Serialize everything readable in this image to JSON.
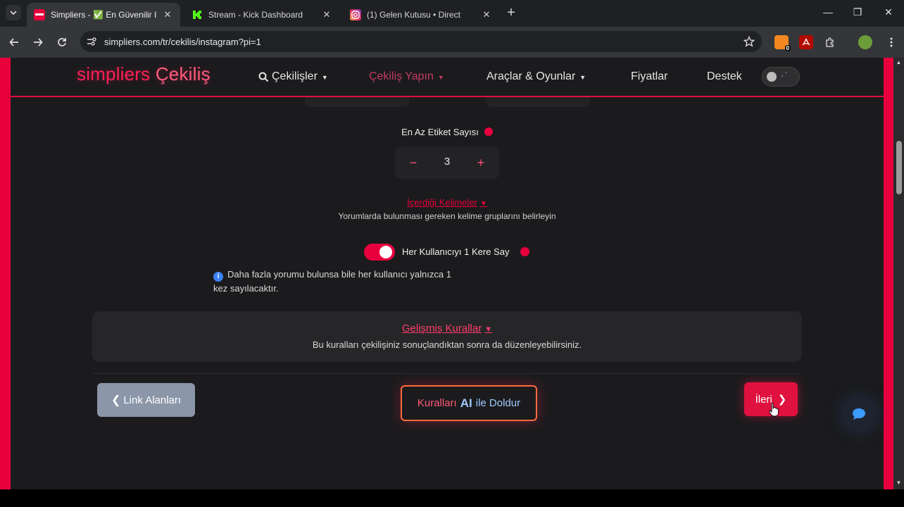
{
  "browser": {
    "tabs": [
      {
        "title": "Simpliers - ✅ En Güvenilir Inst",
        "active": true
      },
      {
        "title": "Stream - Kick Dashboard",
        "active": false
      },
      {
        "title": "(1) Gelen Kutusu • Direct",
        "active": false
      }
    ],
    "close_glyph": "✕",
    "new_tab_glyph": "+",
    "url": "simpliers.com/tr/cekilis/instagram?pi=1",
    "extension_badge": "0",
    "window_controls": [
      "—",
      "❐",
      "✕"
    ]
  },
  "site": {
    "brand_part1": "simpliers",
    "brand_part2": "Çekiliş",
    "nav": [
      {
        "label": "Çekilişler"
      },
      {
        "label": "Çekiliş Yapın"
      },
      {
        "label": "Araçlar & Oyunlar"
      },
      {
        "label": "Fiyatlar"
      },
      {
        "label": "Destek"
      }
    ]
  },
  "form": {
    "min_tags_label": "En Az Etiket Sayısı",
    "min_tags_value": "3",
    "minus": "−",
    "plus": "+",
    "words_link": "İçerdiği Kelimeler",
    "words_desc": "Yorumlarda bulunması gereken kelime gruplarını belirleyin",
    "count_once_label": "Her Kullanıcıyı 1 Kere Say",
    "count_once_on": true,
    "info_text": "Daha fazla yorumu bulunsa bile her kullanıcı yalnızca 1 kez sayılacaktır.",
    "info_icon": "i",
    "advanced_title": "Gelişmiş Kurallar",
    "advanced_desc": "Bu kuralları çekilişiniz sonuçlandıktan sonra da düzenleyebilirsiniz."
  },
  "actions": {
    "back_label": "Link Alanları",
    "ai_part1": "Kuralları",
    "ai_part2": "AI",
    "ai_part3": "ile Doldur",
    "next_label": "İleri"
  },
  "colors": {
    "accent": "#e8003d",
    "brand": "#ff1f55",
    "back_button": "#8b96a8",
    "page_bg": "#1b1b1d"
  },
  "icons": [
    "search-icon",
    "chevron-down-icon",
    "chevron-left-icon",
    "chevron-right-icon",
    "info-icon",
    "chat-icon",
    "star-icon",
    "reload-icon"
  ]
}
